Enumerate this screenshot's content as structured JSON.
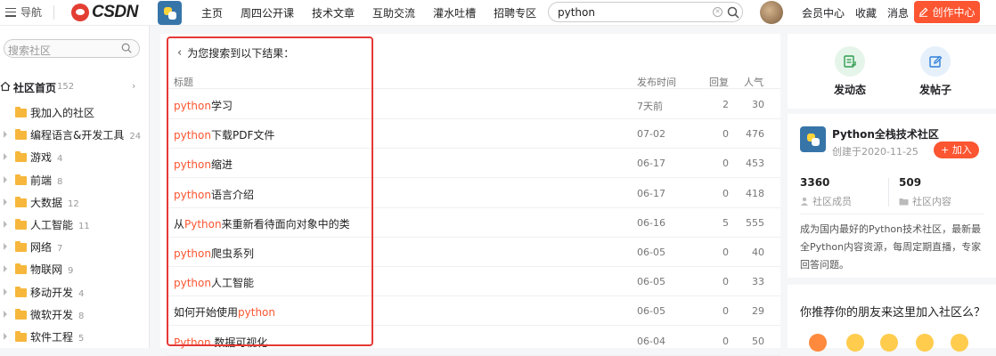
{
  "header": {
    "nav_label": "导航",
    "logo_text": "CSDN",
    "links": [
      "主页",
      "周四公开课",
      "技术文章",
      "互助交流",
      "灌水吐槽",
      "招聘专区",
      "···"
    ],
    "search_value": "python",
    "user_links": [
      "会员中心",
      "收藏",
      "消息"
    ],
    "create_label": "创作中心"
  },
  "sidebar": {
    "search_placeholder": "搜索社区",
    "home": {
      "label": "社区首页",
      "count": "152"
    },
    "items": [
      {
        "label": "我加入的社区",
        "count": "",
        "expandable": false
      },
      {
        "label": "编程语言&开发工具",
        "count": "24",
        "expandable": true
      },
      {
        "label": "游戏",
        "count": "4",
        "expandable": true
      },
      {
        "label": "前端",
        "count": "8",
        "expandable": true
      },
      {
        "label": "大数据",
        "count": "12",
        "expandable": true
      },
      {
        "label": "人工智能",
        "count": "11",
        "expandable": true
      },
      {
        "label": "网络",
        "count": "7",
        "expandable": true
      },
      {
        "label": "物联网",
        "count": "9",
        "expandable": true
      },
      {
        "label": "移动开发",
        "count": "4",
        "expandable": true
      },
      {
        "label": "微软开发",
        "count": "8",
        "expandable": true
      },
      {
        "label": "软件工程",
        "count": "5",
        "expandable": true
      }
    ]
  },
  "results": {
    "heading": "为您搜索到以下结果：",
    "columns": {
      "title": "标题",
      "date": "发布时间",
      "replies": "回复",
      "popularity": "人气"
    },
    "rows": [
      {
        "pre": "",
        "hl": "python",
        "post": "学习",
        "date": "7天前",
        "replies": "2",
        "popularity": "30"
      },
      {
        "pre": "",
        "hl": "python",
        "post": "下载PDF文件",
        "date": "07-02",
        "replies": "0",
        "popularity": "476"
      },
      {
        "pre": "",
        "hl": "python",
        "post": "缩进",
        "date": "06-17",
        "replies": "0",
        "popularity": "453"
      },
      {
        "pre": "",
        "hl": "python",
        "post": "语言介绍",
        "date": "06-17",
        "replies": "0",
        "popularity": "418"
      },
      {
        "pre": "从",
        "hl": "Python",
        "post": "来重新看待面向对象中的类",
        "date": "06-16",
        "replies": "5",
        "popularity": "555"
      },
      {
        "pre": "",
        "hl": "python",
        "post": "爬虫系列",
        "date": "06-05",
        "replies": "0",
        "popularity": "40"
      },
      {
        "pre": "",
        "hl": "python",
        "post": "人工智能",
        "date": "06-05",
        "replies": "0",
        "popularity": "33"
      },
      {
        "pre": "如何开始使用",
        "hl": "python",
        "post": "",
        "date": "06-05",
        "replies": "0",
        "popularity": "29"
      },
      {
        "pre": "",
        "hl": "Python",
        "post": " 数据可视化",
        "date": "06-04",
        "replies": "0",
        "popularity": "50"
      }
    ]
  },
  "actions": {
    "post_update": "发动态",
    "post_thread": "发帖子"
  },
  "community": {
    "name": "Python全栈技术社区",
    "created": "创建于2020-11-25",
    "join_label": "+ 加入",
    "members_count": "3360",
    "members_label": "社区成员",
    "content_count": "509",
    "content_label": "社区内容",
    "description": "成为国内最好的Python技术社区，最新最全Python内容资源，每周定期直播，专家回答问题。"
  },
  "recommend": {
    "question": "你推荐你的朋友来这里加入社区么？"
  },
  "colors": {
    "accent": "#fc5531",
    "highlight_box": "#e53935",
    "python_blue": "#3775a9"
  }
}
